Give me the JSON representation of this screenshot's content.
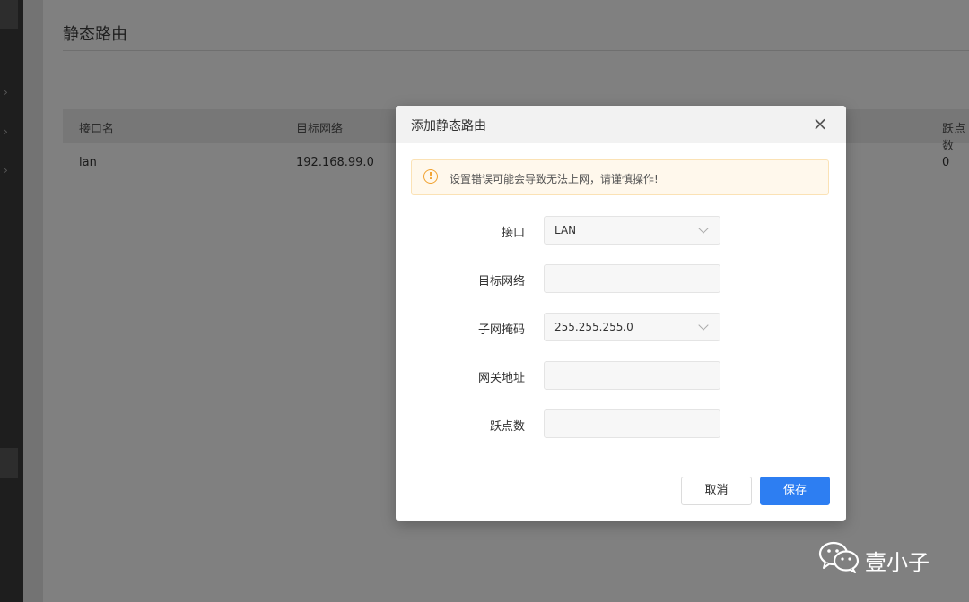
{
  "page": {
    "title": "静态路由",
    "table": {
      "headers": [
        "接口名",
        "目标网络",
        "跃点数"
      ],
      "rows": [
        {
          "interface": "lan",
          "target": "192.168.99.0",
          "hops": "0"
        }
      ]
    }
  },
  "modal": {
    "title": "添加静态路由",
    "warning": "设置错误可能会导致无法上网，请谨慎操作!",
    "fields": {
      "interface": {
        "label": "接口",
        "value": "LAN"
      },
      "target": {
        "label": "目标网络",
        "value": ""
      },
      "mask": {
        "label": "子网掩码",
        "value": "255.255.255.0"
      },
      "gateway": {
        "label": "网关地址",
        "value": ""
      },
      "hops": {
        "label": "跃点数",
        "value": ""
      }
    },
    "cancel_label": "取消",
    "save_label": "保存"
  },
  "watermark": {
    "text": "壹小子"
  },
  "icons": {
    "close": "close-icon",
    "warning": "warning-icon",
    "chevron": "chevron-down-icon"
  },
  "colors": {
    "primary": "#2d7ef2",
    "warning": "#f1a230"
  }
}
